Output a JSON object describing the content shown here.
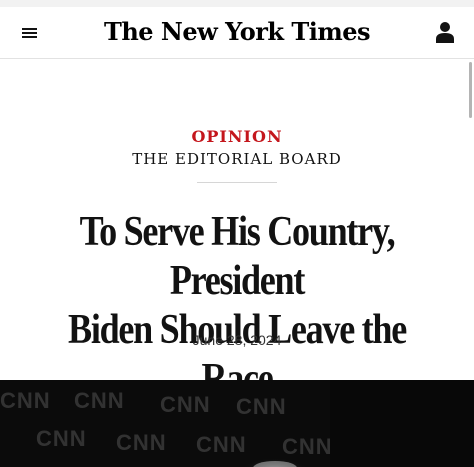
{
  "header": {
    "logo": "The New York Times",
    "icons": {
      "menu": "hamburger-menu-icon",
      "account": "person-icon"
    }
  },
  "article": {
    "kicker": "OPINION",
    "byline": "THE EDITORIAL BOARD",
    "headline_line1": "To Serve His Country, President",
    "headline_line2": "Biden Should Leave the Race",
    "date": "June 28, 2024"
  },
  "photo": {
    "backdrop_text": "CNN"
  },
  "colors": {
    "opinion_red": "#c4161c",
    "text": "#121212",
    "photo_background": "#0b0b0b"
  }
}
